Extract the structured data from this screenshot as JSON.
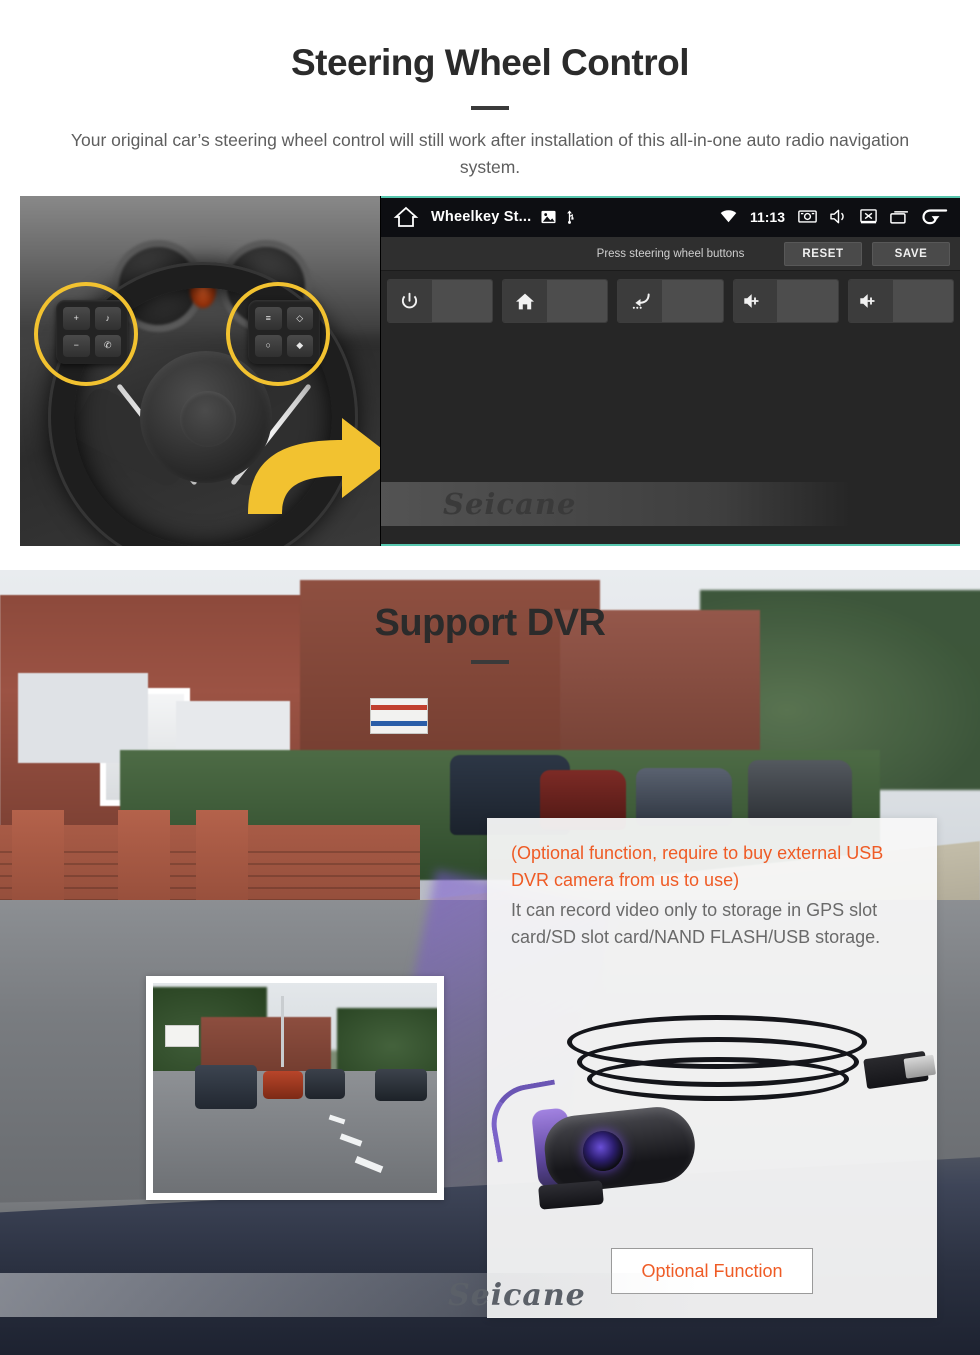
{
  "sections": {
    "steering_wheel": {
      "title": "Steering Wheel Control",
      "subtitle": "Your original car’s steering wheel control will still work after installation of this all-in-one auto radio navigation system.",
      "watermark": "Seicane",
      "head_unit": {
        "status_bar": {
          "home_icon": "home-icon",
          "app_title": "Wheelkey St...",
          "image_icon": "image-icon",
          "usb_icon": "usb-icon",
          "wifi_icon": "wifi-icon",
          "time": "11:13",
          "screenshot_icon": "screenshot-icon",
          "volume_icon": "volume-icon",
          "display-off_icon": "display-off-icon",
          "recents_icon": "recents-icon",
          "back_icon": "back-arrow-icon"
        },
        "toolbar": {
          "hint": "Press steering wheel buttons",
          "reset_label": "RESET",
          "save_label": "SAVE"
        },
        "key_tiles": [
          {
            "icon": "power-icon",
            "value": ""
          },
          {
            "icon": "home-icon",
            "value": ""
          },
          {
            "icon": "back-icon",
            "value": ""
          },
          {
            "icon": "volume-up-icon",
            "value": ""
          },
          {
            "icon": "volume-up-icon",
            "value": ""
          }
        ]
      },
      "photo": {
        "alt": "steering-wheel-photo",
        "left_pad_keys": [
          "+",
          "♪",
          "−",
          "✆"
        ],
        "right_pad_keys": [
          "≡",
          "◇",
          "○",
          "◆"
        ],
        "highlight_color": "#F2C230",
        "arrow_color": "#F2C230"
      }
    },
    "dvr": {
      "title": "Support DVR",
      "panel": {
        "highlight_text": "(Optional function, require to buy external USB DVR camera from us to use)",
        "body_text": "It can record video only to storage in GPS slot card/SD slot card/NAND FLASH/USB storage.",
        "button_label": "Optional Function",
        "product_alt": "usb-dvr-camera-image"
      },
      "inset_alt": "dashcam-recording-preview",
      "background_alt": "street-view-through-windshield",
      "watermark": "Seicane"
    }
  },
  "colors": {
    "accent_orange": "#ef5b25",
    "highlight_yellow": "#F2C230",
    "title_dark": "#2b2b2b",
    "body_grey": "#6a6a6a",
    "headunit_bg": "#262626",
    "statusbar_bg": "#0d0e12"
  }
}
